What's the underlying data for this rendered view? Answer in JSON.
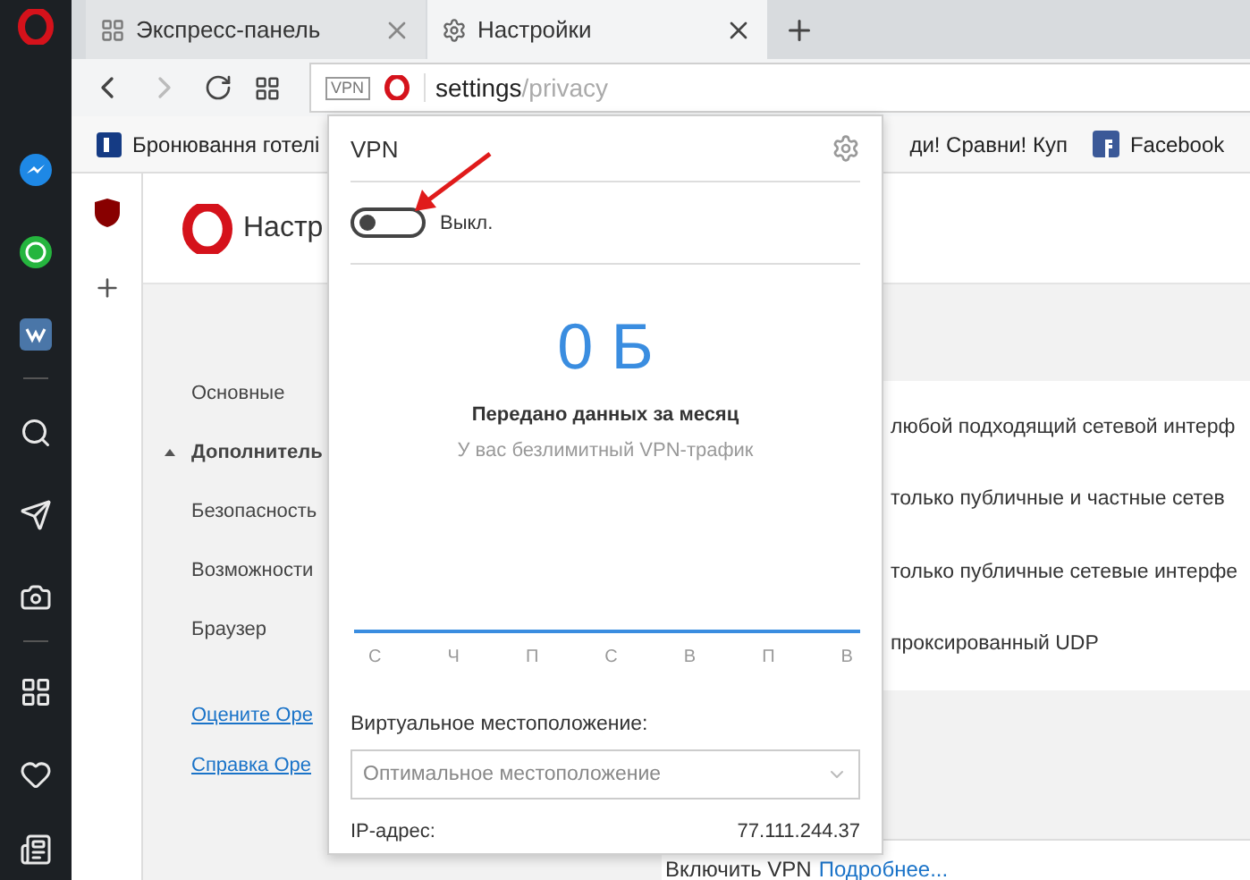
{
  "tabs": [
    {
      "label": "Экспресс-панель",
      "kind": "speed-dial",
      "selected": false
    },
    {
      "label": "Настройки",
      "kind": "settings",
      "selected": true
    }
  ],
  "address": {
    "badge": "VPN",
    "host": "settings",
    "path": "/privacy"
  },
  "bookmarks": [
    {
      "label": "Бронювання готелі",
      "kind": "booking"
    },
    {
      "label": "ди! Сравни! Куп",
      "kind": "plain"
    },
    {
      "label": "Facebook",
      "kind": "facebook"
    }
  ],
  "settings": {
    "title": "Настр",
    "nav": [
      {
        "label": "Основные",
        "kind": "section",
        "expanded": false
      },
      {
        "label": "Дополнитель",
        "kind": "section",
        "expanded": true
      },
      {
        "label": "Безопасность",
        "kind": "item"
      },
      {
        "label": "Возможности",
        "kind": "item"
      },
      {
        "label": "Браузер",
        "kind": "item"
      }
    ],
    "links": [
      "Оцените Ope",
      "Справка Ope"
    ],
    "options": [
      "любой подходящий сетевой интерф",
      "только публичные и частные сетев",
      "только публичные сетевые интерфе",
      "проксированный UDP"
    ],
    "footer": {
      "text": "Включить VPN",
      "link": "Подробнее..."
    }
  },
  "vpn_popup": {
    "title": "VPN",
    "on": false,
    "state_label": "Выкл.",
    "amount": "0 Б",
    "amount_caption": "Передано данных за месяц",
    "note": "У вас безлимитный VPN-трафик",
    "days": [
      "С",
      "Ч",
      "П",
      "С",
      "В",
      "П",
      "В"
    ],
    "location_label": "Виртуальное местоположение:",
    "location": "Оптимальное местоположение",
    "ip_label": "IP-адрес:",
    "ip": "77.111.244.37"
  }
}
